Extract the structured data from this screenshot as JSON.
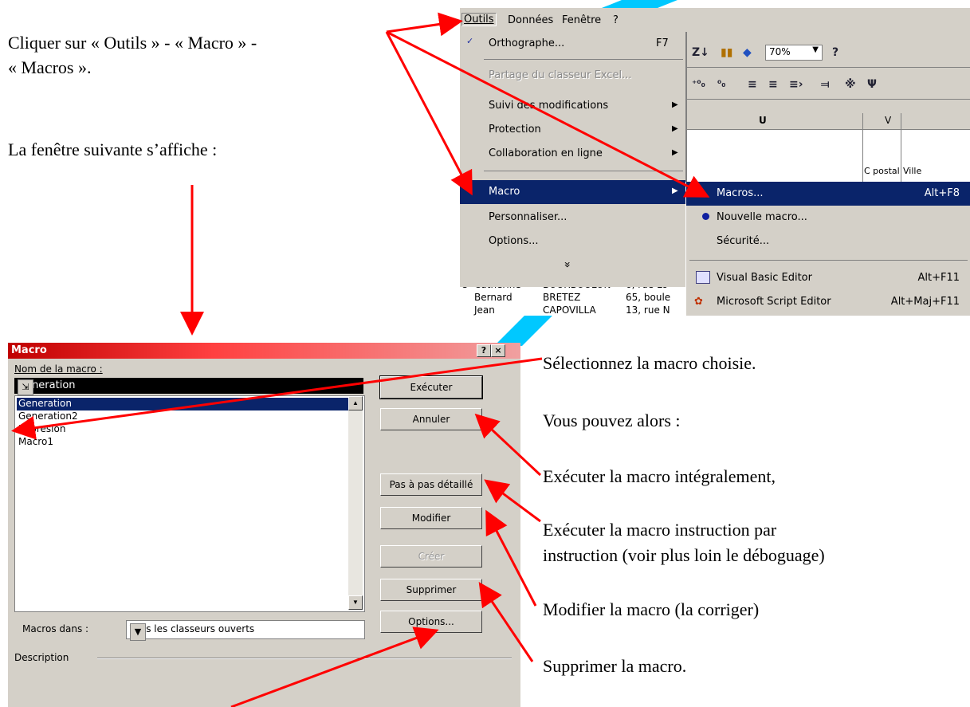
{
  "instructions": {
    "step1_line1": "Cliquer sur « Outils » - « Macro » -",
    "step1_line2": "« Macros ».",
    "window_appears": "La fenêtre suivante s’affiche :",
    "select_macro": "Sélectionnez la macro choisie.",
    "you_can": "Vous pouvez alors :",
    "execute": "Exécuter la macro intégralement,",
    "step_line1": "Exécuter la macro instruction par",
    "step_line2": "instruction (voir plus loin le déboguage)",
    "modify": "Modifier la macro (la corriger)",
    "delete": "Supprimer la macro."
  },
  "excel": {
    "menubar": [
      "Outils",
      "Données",
      "Fenêtre",
      "?"
    ],
    "outils_menu": [
      {
        "label": "Orthographe...",
        "shortcut": "F7",
        "icon": "spellcheck-icon"
      },
      {
        "label": "Partage du classeur Excel...",
        "disabled": true
      },
      {
        "label": "Suivi des modifications",
        "submenu": true
      },
      {
        "label": "Protection",
        "submenu": true
      },
      {
        "label": "Collaboration en ligne",
        "submenu": true
      },
      {
        "label": "Macro",
        "submenu": true,
        "selected": true
      },
      {
        "label": "Personnaliser..."
      },
      {
        "label": "Options..."
      }
    ],
    "more_chevron": "»",
    "macro_submenu": [
      {
        "label": "Macros...",
        "shortcut": "Alt+F8",
        "selected": true
      },
      {
        "label": "Nouvelle macro...",
        "icon": "record-dot-icon"
      },
      {
        "label": "Sécurité..."
      },
      {
        "label": "Visual Basic Editor",
        "shortcut": "Alt+F11",
        "icon": "vb-editor-icon"
      },
      {
        "label": "Microsoft Script Editor",
        "shortcut": "Alt+Maj+F11",
        "icon": "script-editor-icon"
      }
    ],
    "toolbar": {
      "zoom": "70%"
    },
    "sheet": {
      "col_headers": [
        "U",
        "V"
      ],
      "row_text": [
        "C postal",
        "Ville"
      ]
    },
    "background_cells": [
      [
        "e",
        "Catherine",
        "BOURBOULON",
        "6, rue Lo"
      ],
      [
        "",
        "Bernard",
        "BRETEZ",
        "65, boule"
      ],
      [
        "",
        "Jean",
        "CAPOVILLA",
        "13, rue N"
      ]
    ]
  },
  "dialog": {
    "title": "Macro",
    "help_btn": "?",
    "close_btn": "×",
    "name_label": "Nom de la macro :",
    "name_value": "Generation",
    "macros": [
      "Generation",
      "Generation2",
      "Impresion",
      "Macro1"
    ],
    "selected_index": 0,
    "buttons": {
      "run": "Exécuter",
      "cancel": "Annuler",
      "step": "Pas à pas détaillé",
      "edit": "Modifier",
      "create": "Créer",
      "delete": "Supprimer",
      "options": "Options..."
    },
    "macros_in_label": "Macros dans :",
    "macros_in_value": "Tous les classeurs ouverts",
    "description_label": "Description"
  }
}
